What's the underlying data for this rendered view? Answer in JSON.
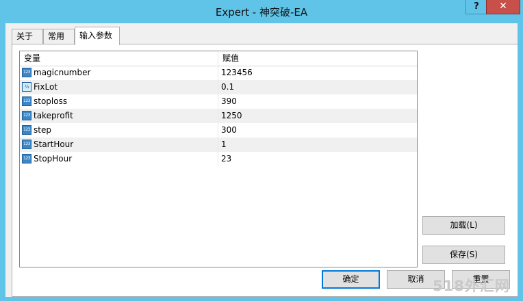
{
  "window": {
    "title": "Expert - 神突破-EA",
    "help_label": "?",
    "close_label": "✕"
  },
  "tabs": [
    {
      "label": "关于",
      "active": false
    },
    {
      "label": "常用",
      "active": false
    },
    {
      "label": "输入参数",
      "active": true
    }
  ],
  "grid": {
    "columns": {
      "name": "变量",
      "value": "赋值"
    },
    "rows": [
      {
        "name": "magicnumber",
        "value": "123456",
        "icon": "integer-icon"
      },
      {
        "name": "FixLot",
        "value": "0.1",
        "icon": "double-icon"
      },
      {
        "name": "stoploss",
        "value": "390",
        "icon": "integer-icon"
      },
      {
        "name": "takeprofit",
        "value": "1250",
        "icon": "integer-icon"
      },
      {
        "name": "step",
        "value": "300",
        "icon": "integer-icon"
      },
      {
        "name": "StartHour",
        "value": "1",
        "icon": "integer-icon"
      },
      {
        "name": "StopHour",
        "value": "23",
        "icon": "integer-icon"
      }
    ],
    "icon_text": {
      "integer": "123",
      "double": "½"
    }
  },
  "buttons": {
    "load": "加载(L)",
    "save": "保存(S)",
    "ok": "确定",
    "cancel": "取消",
    "reset": "重置"
  },
  "watermark": "518外汇网",
  "colors": {
    "titlebar": "#5fc4e8",
    "close": "#c7504b",
    "default_border": "#0078d7"
  }
}
